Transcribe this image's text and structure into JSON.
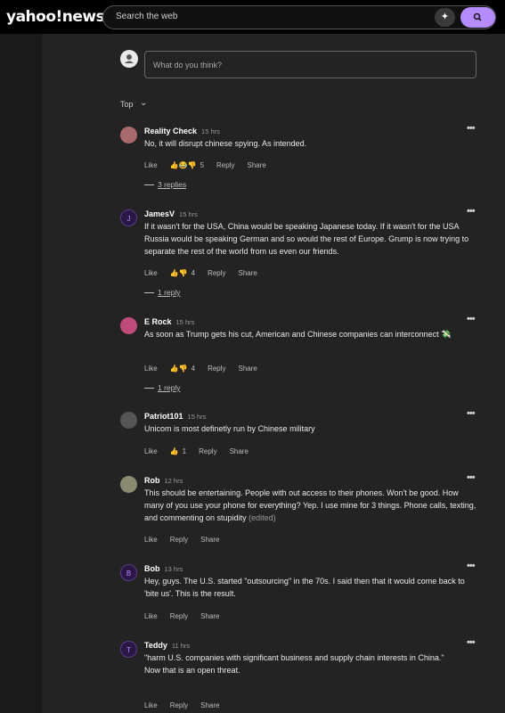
{
  "header": {
    "logo": "yahoo!news",
    "search_placeholder": "Search the web",
    "ai_icon": "sparkle-icon",
    "search_icon": "magnifier-icon",
    "accent": "#b58cff"
  },
  "compose": {
    "placeholder": "What do you think?"
  },
  "sort": {
    "label": "Top"
  },
  "comments": [
    {
      "name": "Reality Check",
      "time": "15 hrs",
      "text": "No, it will disrupt chinese spying. As intended.",
      "like": "Like",
      "reactions": "👍😂👎",
      "count": "5",
      "reply": "Reply",
      "share": "Share",
      "replies": "3 replies"
    },
    {
      "name": "JamesV",
      "initial": "J",
      "time": "15 hrs",
      "text": "If it wasn't for the USA, China would be speaking Japanese today. If it wasn't for the USA Russia would be speaking German and so would the rest of Europe. Grump is now trying to separate the rest of the world from us even our friends.",
      "like": "Like",
      "reactions": "👍👎",
      "count": "4",
      "reply": "Reply",
      "share": "Share",
      "replies": "1 reply"
    },
    {
      "name": "E Rock",
      "time": "15 hrs",
      "text": "As soon as Trump gets his cut, American and Chinese companies can interconnect 💸",
      "like": "Like",
      "reactions": "👍👎",
      "count": "4",
      "reply": "Reply",
      "share": "Share",
      "replies": "1 reply"
    },
    {
      "name": "Patriot101",
      "time": "15 hrs",
      "text": "Unicom is most definetly run by Chinese military",
      "like": "Like",
      "reactions": "👍",
      "count": "1",
      "reply": "Reply",
      "share": "Share"
    },
    {
      "name": "Rob",
      "time": "12 hrs",
      "text": "This should be entertaining. People with out access to their phones. Won't be good. How many of you use your phone for everything? Yep. I use mine for 3 things. Phone calls, texting, and commenting on stupidity",
      "edited": "(edited)",
      "like": "Like",
      "reply": "Reply",
      "share": "Share"
    },
    {
      "name": "Bob",
      "initial": "B",
      "time": "13 hrs",
      "text": "Hey, guys. The U.S. started \"outsourcing\" in the 70s. I said then that it would come back to 'bite us'. This is the result.",
      "like": "Like",
      "reply": "Reply",
      "share": "Share"
    },
    {
      "name": "Teddy",
      "initial": "T",
      "time": "11 hrs",
      "text": "\"harm U.S. companies with significant business and supply chain interests in China.\"",
      "text2": "Now that is an open threat.",
      "like": "Like",
      "reply": "Reply",
      "share": "Share"
    }
  ]
}
